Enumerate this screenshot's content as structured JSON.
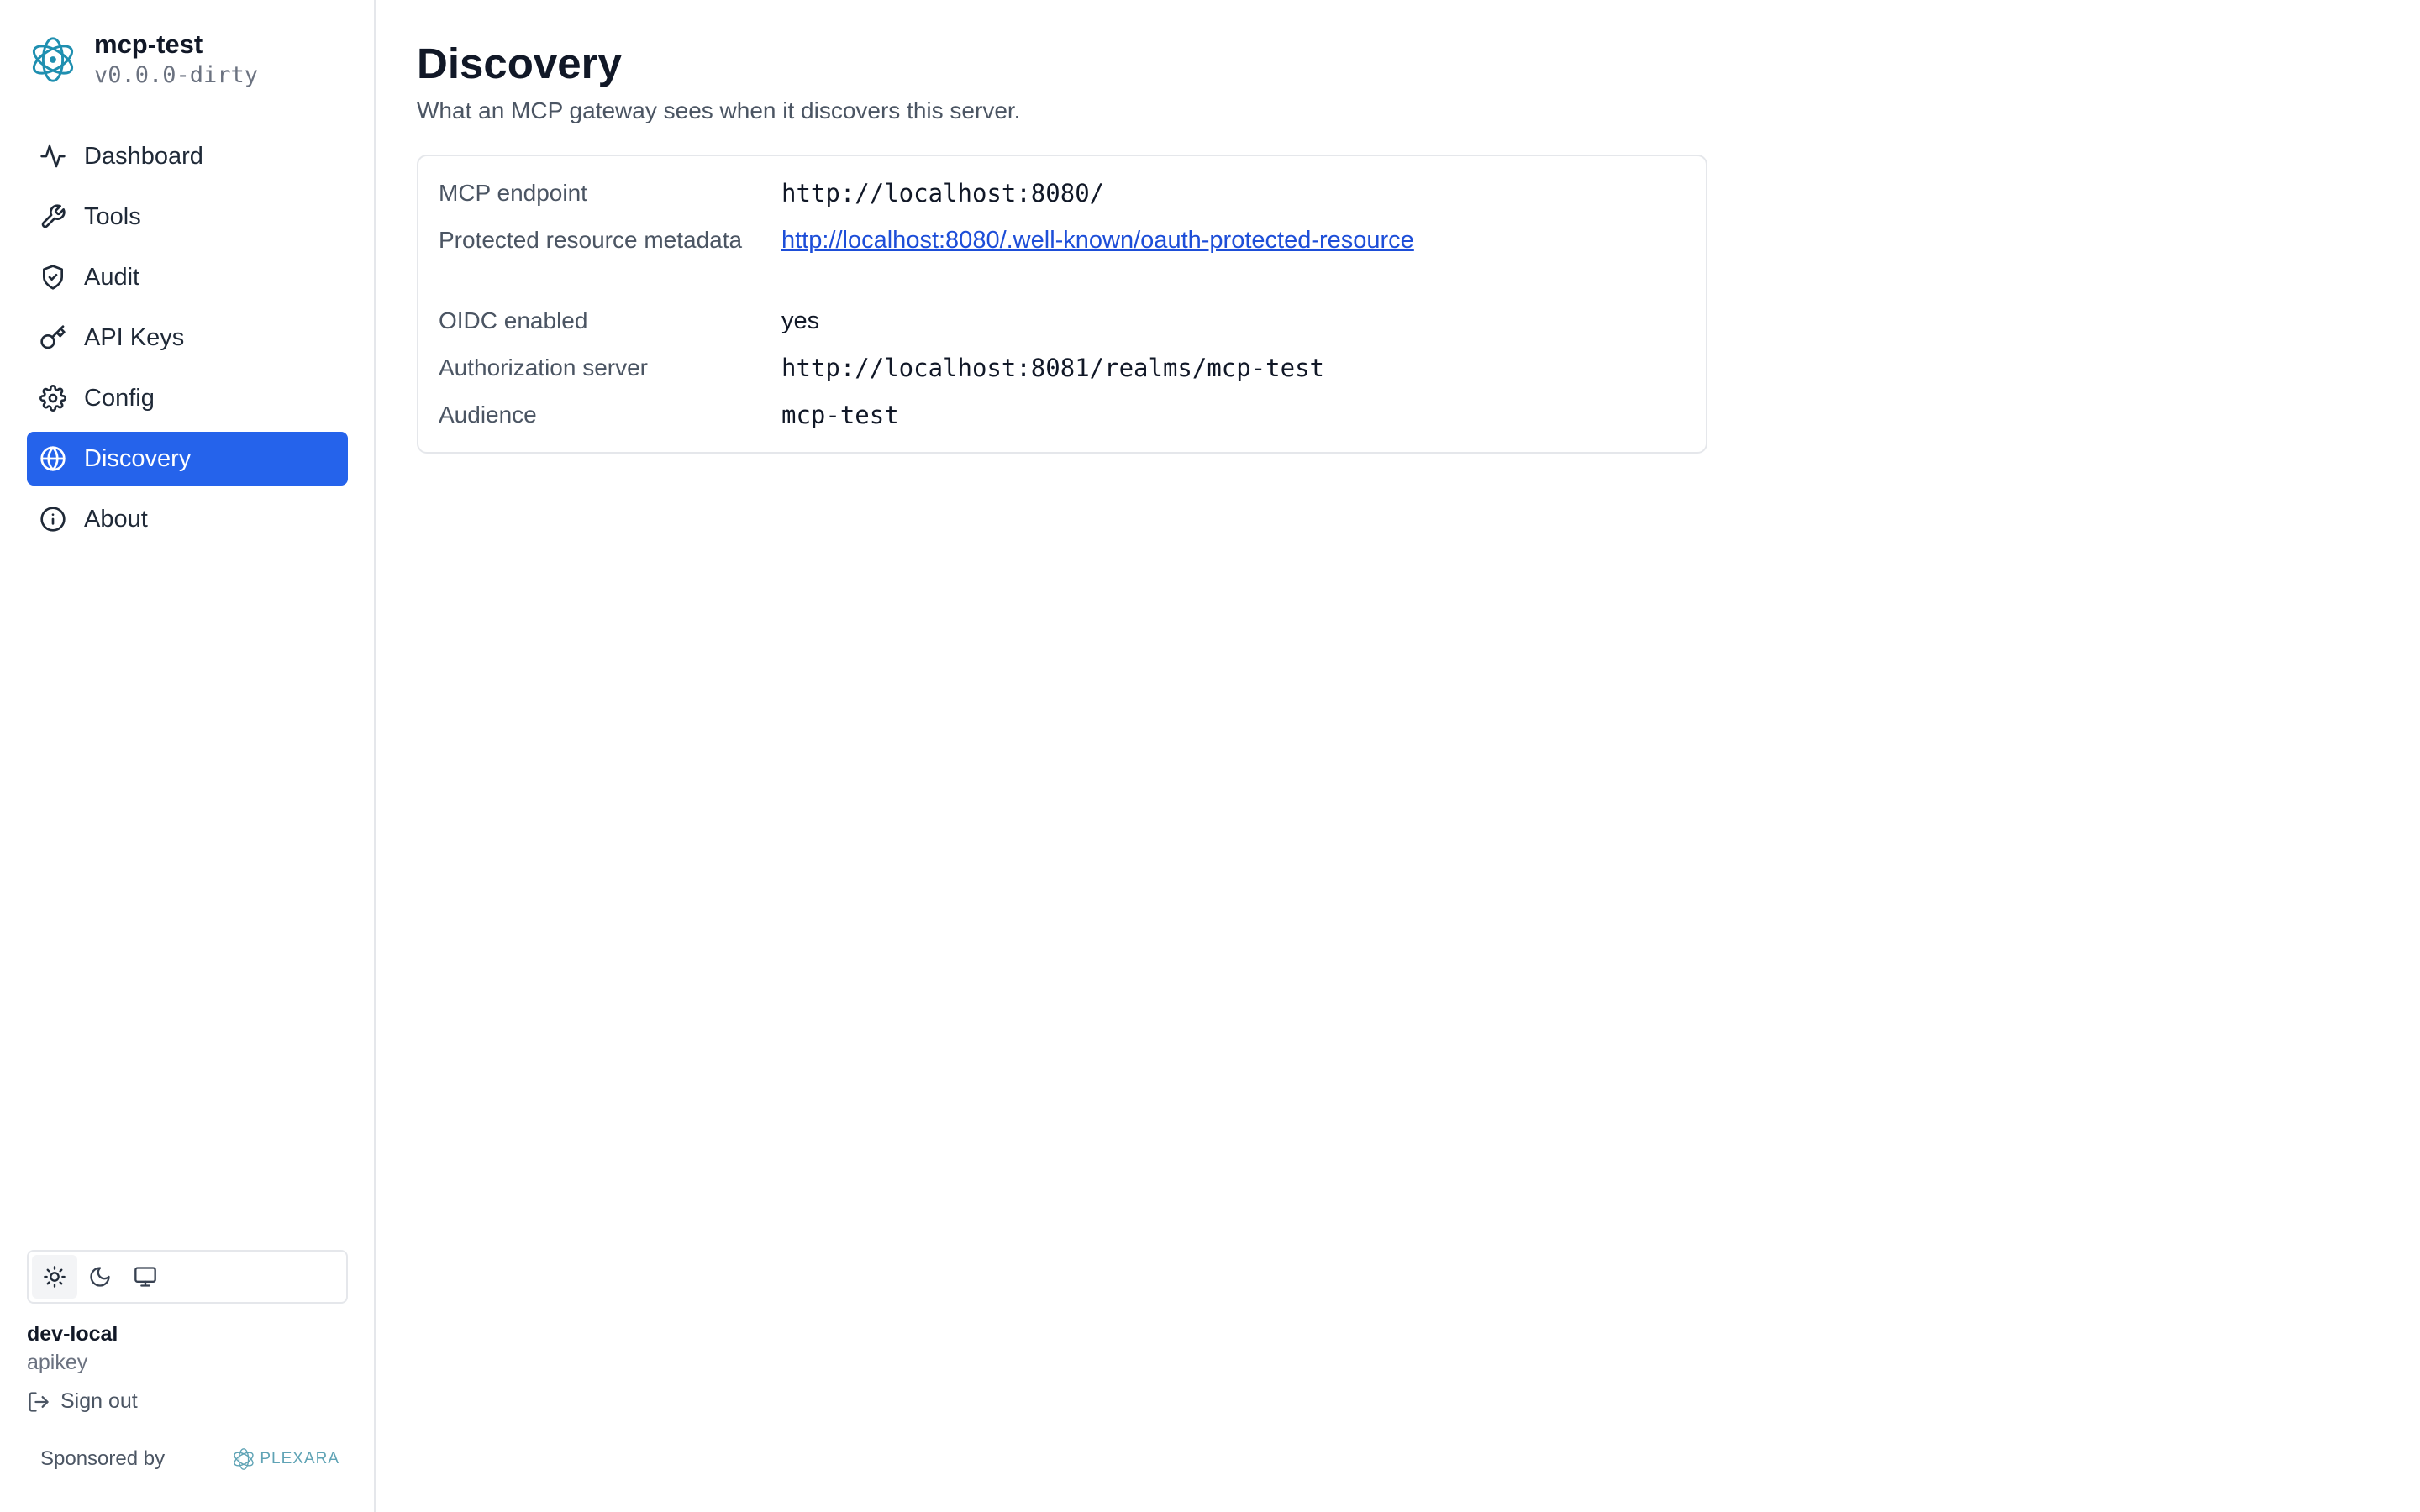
{
  "app": {
    "name": "mcp-test",
    "version": "v0.0.0-dirty"
  },
  "sidebar": {
    "items": [
      {
        "label": "Dashboard",
        "icon": "activity-icon",
        "active": false
      },
      {
        "label": "Tools",
        "icon": "wrench-icon",
        "active": false
      },
      {
        "label": "Audit",
        "icon": "shield-check-icon",
        "active": false
      },
      {
        "label": "API Keys",
        "icon": "key-icon",
        "active": false
      },
      {
        "label": "Config",
        "icon": "gear-icon",
        "active": false
      },
      {
        "label": "Discovery",
        "icon": "globe-icon",
        "active": true
      },
      {
        "label": "About",
        "icon": "info-icon",
        "active": false
      }
    ],
    "theme_options": [
      "light",
      "dark",
      "system"
    ],
    "theme_selected": "light",
    "user": {
      "name": "dev-local",
      "method": "apikey"
    },
    "sign_out_label": "Sign out",
    "sponsor": {
      "label": "Sponsored by",
      "logo_text": "PLEXARA"
    }
  },
  "main": {
    "title": "Discovery",
    "subtitle": "What an MCP gateway sees when it discovers this server.",
    "rows": [
      {
        "label": "MCP endpoint",
        "value": "http://localhost:8080/",
        "kind": "mono"
      },
      {
        "label": "Protected resource metadata",
        "value": "http://localhost:8080/.well-known/oauth-protected-resource",
        "kind": "link"
      },
      {
        "label": "OIDC enabled",
        "value": "yes",
        "kind": "text"
      },
      {
        "label": "Authorization server",
        "value": "http://localhost:8081/realms/mcp-test",
        "kind": "mono"
      },
      {
        "label": "Audience",
        "value": "mcp-test",
        "kind": "mono"
      }
    ]
  },
  "colors": {
    "accent": "#2563eb",
    "link": "#1d4ed8",
    "logo": "#1f8fb0"
  }
}
